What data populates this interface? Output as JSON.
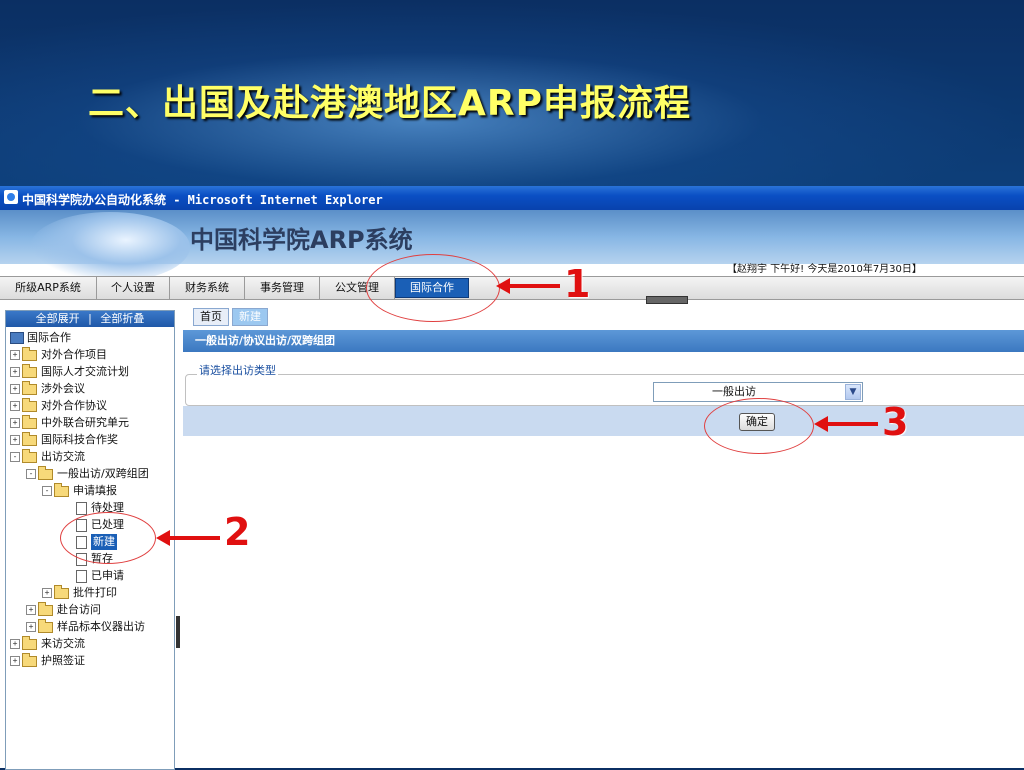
{
  "slide": {
    "title": "二、出国及赴港澳地区ARP申报流程"
  },
  "browser": {
    "window_title": "中国科学院办公自动化系统 - Microsoft Internet Explorer"
  },
  "app": {
    "title": "中国科学院ARP系统",
    "greeting": "【赵翔宇 下午好! 今天是2010年7月30日】"
  },
  "menu": {
    "items": [
      {
        "label": "所级ARP系统"
      },
      {
        "label": "个人设置"
      },
      {
        "label": "财务系统"
      },
      {
        "label": "事务管理"
      },
      {
        "label": "公文管理"
      },
      {
        "label": "国际合作"
      }
    ]
  },
  "tree": {
    "expand_label": "全部展开",
    "sep": "|",
    "collapse_label": "全部折叠",
    "root": "国际合作",
    "nodes": [
      "对外合作项目",
      "国际人才交流计划",
      "涉外会议",
      "对外合作协议",
      "中外联合研究单元",
      "国际科技合作奖",
      "出访交流",
      "一般出访/双跨组团",
      "申请填报",
      "待处理",
      "已处理",
      "新建",
      "暂存",
      "已申请",
      "批件打印",
      "赴台访问",
      "样品标本仪器出访",
      "来访交流",
      "护照签证"
    ]
  },
  "content": {
    "tabs": [
      {
        "label": "首页"
      },
      {
        "label": "新建"
      }
    ],
    "section_title": "一般出访/协议出访/双跨组团",
    "fieldset_legend": "请选择出访类型",
    "visit_type_selected": "一般出访",
    "confirm_label": "确定"
  },
  "annotations": {
    "markers": [
      "1",
      "2",
      "3"
    ],
    "color": "#e01010"
  }
}
